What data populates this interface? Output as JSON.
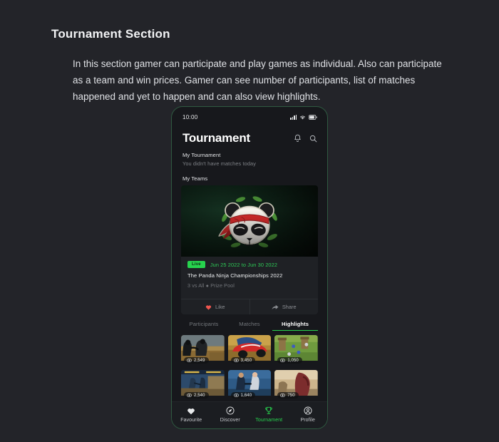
{
  "doc": {
    "title": "Tournament Section",
    "body": "In this section gamer can participate and play games as individual. Also can participate as a team and win prices. Gamer can see number of participants, list of matches happened and yet to happen and can also view highlights."
  },
  "phone": {
    "statusbar": {
      "time": "10:00",
      "icons": [
        "signal-icon",
        "wifi-icon",
        "battery-icon"
      ]
    },
    "header": {
      "title": "Tournament",
      "icons": [
        "bell-icon",
        "search-icon"
      ]
    },
    "my_tournament": {
      "label": "My Tournament",
      "subtitle": "You didn't have matches today"
    },
    "my_teams_label": "My Teams",
    "card": {
      "badge": "Live",
      "date_range": "Jun 25 2022 to Jun 30 2022",
      "title": "The Panda Ninja Championships 2022",
      "subtitle": "3 vs All ● Prize Pool",
      "actions": [
        {
          "label": "Like",
          "icon": "heart-icon",
          "color": "#f0564f"
        },
        {
          "label": "Share",
          "icon": "share-arrow-icon",
          "color": "#8a8d92"
        }
      ]
    },
    "tabs": [
      {
        "label": "Participants",
        "active": false
      },
      {
        "label": "Matches",
        "active": false
      },
      {
        "label": "Highlights",
        "active": true
      }
    ],
    "highlights": [
      {
        "views": "2,549",
        "icon": "views-icon"
      },
      {
        "views": "3,450",
        "icon": "views-icon"
      },
      {
        "views": "1,050",
        "icon": "views-icon"
      },
      {
        "views": "2,540",
        "icon": "views-icon"
      },
      {
        "views": "1,640",
        "icon": "views-icon"
      },
      {
        "views": "750",
        "icon": "views-icon"
      }
    ],
    "bottom_nav": [
      {
        "label": "Favourite",
        "icon": "heart-icon",
        "active": false
      },
      {
        "label": "Discover",
        "icon": "compass-icon",
        "active": false
      },
      {
        "label": "Tournament",
        "icon": "trophy-icon",
        "active": true
      },
      {
        "label": "Profile",
        "icon": "person-icon",
        "active": false
      }
    ]
  },
  "colors": {
    "page_bg": "#232429",
    "phone_bg": "#17181c",
    "accent_green": "#27d34e",
    "like_red": "#f0564f",
    "frame_border": "#2f5a41"
  }
}
